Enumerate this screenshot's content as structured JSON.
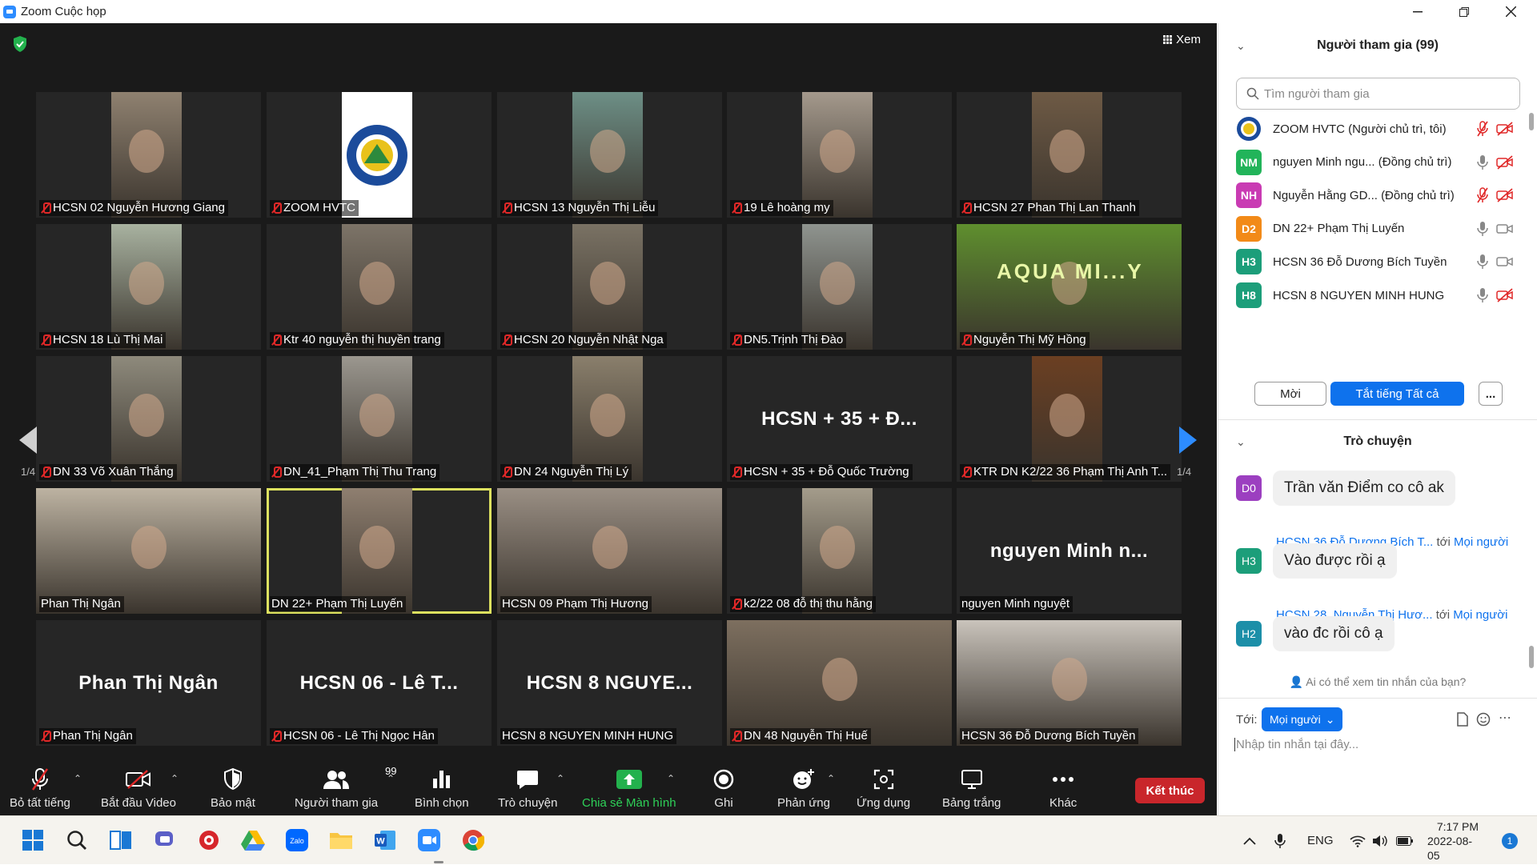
{
  "window": {
    "title": "Zoom Cuộc họp"
  },
  "view": {
    "label": "Xem"
  },
  "pager": {
    "left": "1/4",
    "right": "1/4"
  },
  "tiles": [
    {
      "name": "HCSN 02 Nguyễn Hương Giang",
      "muted": true,
      "cam": "#8f8170"
    },
    {
      "name": "ZOOM HVTC",
      "muted": true,
      "logo": true
    },
    {
      "name": "HCSN 13 Nguyễn Thị Liễu",
      "muted": true,
      "cam": "#6d8f86"
    },
    {
      "name": "19 Lê hoàng my",
      "muted": true,
      "cam": "#a4998c"
    },
    {
      "name": "HCSN 27 Phan Thị Lan Thanh",
      "muted": true,
      "cam": "#6e5a45"
    },
    {
      "name": "HCSN 18 Lù Thị Mai",
      "muted": true,
      "cam": "#a8b2a0"
    },
    {
      "name": "Ktr 40 nguyễn thị huyền trang",
      "muted": true,
      "cam": "#7d7468"
    },
    {
      "name": "HCSN 20 Nguyễn Nhật Nga",
      "muted": true,
      "cam": "#7a7264"
    },
    {
      "name": "DN5.Trịnh Thị Đào",
      "muted": true,
      "cam": "#8f948f"
    },
    {
      "name": "Nguyễn Thị Mỹ Hồng",
      "muted": true,
      "cam": "#5f8f2e",
      "wide": true,
      "banner": "AQUA MI...Y"
    },
    {
      "name": "DN 33 Võ Xuân Thắng",
      "muted": true,
      "cam": "#8e8a7c"
    },
    {
      "name": "DN_41_Phạm Thị Thu Trang",
      "muted": true,
      "cam": "#9b978f"
    },
    {
      "name": "DN 24 Nguyễn Thị Lý",
      "muted": true,
      "cam": "#8a7f6c"
    },
    {
      "name": "HCSN + 35 + Đỗ Quốc Trường",
      "muted": true,
      "big": "HCSN + 35 + Đ..."
    },
    {
      "name": "KTR DN K2/22 36 Phạm Thị Anh T...",
      "muted": true,
      "cam": "#6b3f22"
    },
    {
      "name": "Phan Thị Ngân",
      "muted": false,
      "cam": "#bdb3a2",
      "wide": true
    },
    {
      "name": "DN 22+ Phạm Thị Luyến",
      "muted": false,
      "cam": "#8f7f70",
      "active": true
    },
    {
      "name": "HCSN 09 Phạm Thị Hương",
      "muted": false,
      "cam": "#9a8f84",
      "wide": true
    },
    {
      "name": "k2/22 08 đỗ thị thu hằng",
      "muted": true,
      "cam": "#a49c8b"
    },
    {
      "name": "nguyen Minh nguyệt",
      "muted": false,
      "big": "nguyen Minh n..."
    },
    {
      "name": "Phan Thị Ngân",
      "muted": true,
      "big": "Phan Thị Ngân"
    },
    {
      "name": "HCSN 06 - Lê Thị Ngọc Hân",
      "muted": true,
      "big": "HCSN 06 - Lê T..."
    },
    {
      "name": "HCSN 8 NGUYEN MINH HUNG",
      "muted": false,
      "big": "HCSN 8 NGUYE..."
    },
    {
      "name": "DN 48 Nguyễn Thị Huế",
      "muted": true,
      "cam": "#7d6f5f",
      "wide": true
    },
    {
      "name": "HCSN 36 Đỗ Dương Bích Tuyền",
      "muted": false,
      "cam": "#c9c3bb",
      "wide": true
    }
  ],
  "toolbar": {
    "mute_all": "Bỏ tất tiếng",
    "start_video": "Bắt đầu Video",
    "security": "Bảo mật",
    "participants": "Người tham gia",
    "participants_count": "99",
    "polls": "Bình chọn",
    "chat": "Trò chuyện",
    "share": "Chia sẻ Màn hình",
    "record": "Ghi",
    "reactions": "Phản ứng",
    "apps": "Ứng dụng",
    "whiteboard": "Bảng trắng",
    "more": "Khác",
    "end": "Kết thúc"
  },
  "participants_panel": {
    "title": "Người tham gia (99)",
    "search_placeholder": "Tìm người tham gia",
    "rows": [
      {
        "initials": "",
        "color": "#ffffff",
        "logo": true,
        "name": "ZOOM HVTC (Người chủ trì, tôi)",
        "mic_muted": true,
        "video_off": true
      },
      {
        "initials": "NM",
        "color": "#22b45a",
        "name": "nguyen Minh ngu...  (Đồng chủ trì)",
        "mic_muted": false,
        "video_off": true
      },
      {
        "initials": "NH",
        "color": "#c93bb3",
        "name": "Nguyễn Hằng GD...  (Đồng chủ trì)",
        "mic_muted": true,
        "video_off": true
      },
      {
        "initials": "D2",
        "color": "#f28a18",
        "name": "DN 22+ Phạm Thị Luyến",
        "mic_muted": false,
        "video_off": false
      },
      {
        "initials": "H3",
        "color": "#1c9e7a",
        "name": "HCSN 36 Đỗ Dương Bích Tuyền",
        "mic_muted": false,
        "video_off": false
      },
      {
        "initials": "H8",
        "color": "#1c9e7a",
        "name": "HCSN 8 NGUYEN MINH HUNG",
        "mic_muted": false,
        "video_off": true
      }
    ],
    "invite": "Mời",
    "mute_all": "Tắt tiếng Tất cả",
    "more": "..."
  },
  "chat_panel": {
    "title": "Trò chuyện",
    "messages": [
      {
        "initials": "D0",
        "color": "#9c3fc0",
        "sender": "",
        "to": "",
        "audience": "",
        "text": "Trần văn Điểm co cô ak"
      },
      {
        "initials": "H3",
        "color": "#1c9e7a",
        "sender": "HCSN 36 Đỗ Dương Bích T...",
        "to": "tới",
        "audience": "Mọi người",
        "text": "Vào được rồi ạ"
      },
      {
        "initials": "H2",
        "color": "#1c8fa8",
        "sender": "HCSN 28. Nguyễn Thị Hươ...",
        "to": "tới",
        "audience": "Mọi người",
        "text": "vào đc rồi cô ạ"
      }
    ],
    "who_can_see": "Ai có thể xem tin nhắn của bạn?",
    "to_label": "Tới:",
    "to_value": "Mọi người",
    "input_placeholder": "Nhập tin nhắn tại đây..."
  },
  "taskbar": {
    "lang": "ENG",
    "time": "7:17 PM",
    "date": "2022-08-05",
    "notifications": "1"
  }
}
